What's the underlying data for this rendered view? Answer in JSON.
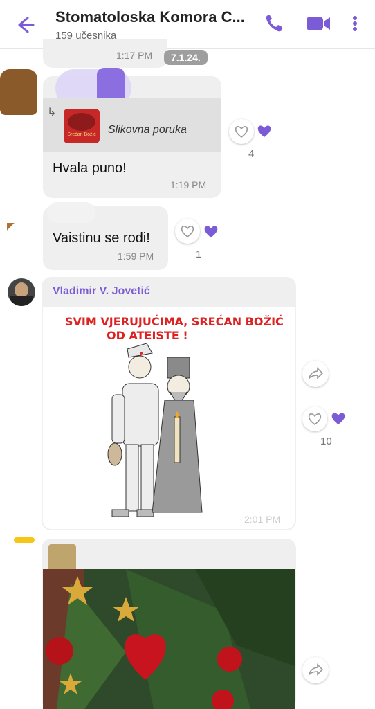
{
  "header": {
    "title": "Stomatoloska Komora C...",
    "subtitle": "159 učesnika"
  },
  "messages": {
    "top_time": "1:17 PM",
    "date_chip": "7.1.24.",
    "reply": {
      "quote_label": "Slikovna poruka",
      "quote_thumb_text": "Srećan Božić",
      "text": "Hvala puno!",
      "time": "1:19 PM",
      "likes": "4"
    },
    "second": {
      "text": "Vaistinu se rodi!",
      "time": "1:59 PM",
      "likes": "1"
    },
    "image_msg": {
      "sender": "Vladimir V. Jovetić",
      "caption_line1": "SVIM VJERUJUĆIMA, SREĆAN BOŽIĆ",
      "caption_line2": "OD ATEISTE !",
      "time": "2:01 PM",
      "likes": "10"
    }
  },
  "colors": {
    "accent": "#7b5cd6",
    "bubble": "#efefef"
  },
  "icons": [
    "back-arrow-icon",
    "phone-icon",
    "video-icon",
    "more-icon",
    "heart-icon",
    "forward-icon"
  ]
}
